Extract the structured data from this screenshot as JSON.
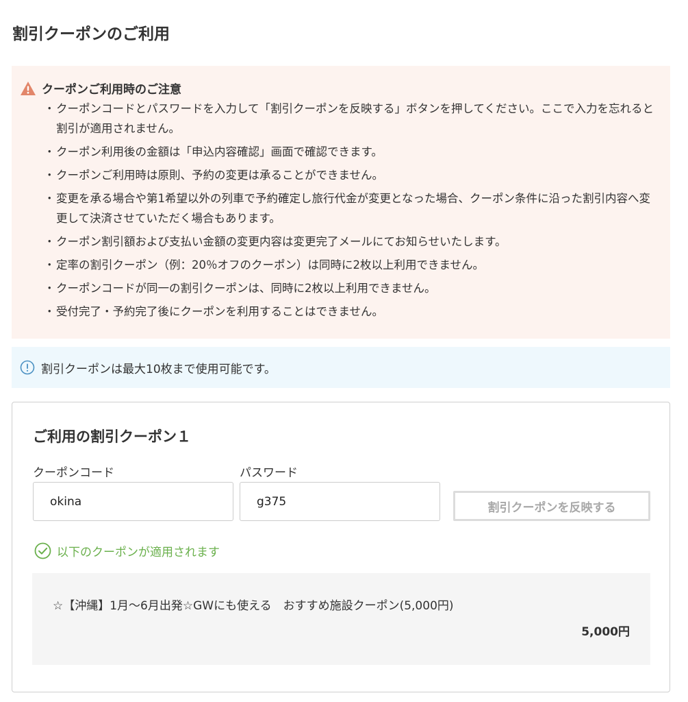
{
  "page": {
    "title": "割引クーポンのご利用"
  },
  "notice": {
    "title": "クーポンご利用時のご注意",
    "items": [
      "クーポンコードとパスワードを入力して「割引クーポンを反映する」ボタンを押してください。ここで入力を忘れると割引が適用されません。",
      "クーポン利用後の金額は「申込内容確認」画面で確認できます。",
      "クーポンご利用時は原則、予約の変更は承ることができません。",
      "変更を承る場合や第1希望以外の列車で予約確定し旅行代金が変更となった場合、クーポン条件に沿った割引内容へ変更して決済させていただく場合もあります。",
      "クーポン割引額および支払い金額の変更内容は変更完了メールにてお知らせいたします。",
      "定率の割引クーポン（例：20％オフのクーポン）は同時に2枚以上利用できません。",
      "クーポンコードが同一の割引クーポンは、同時に2枚以上利用できません。",
      "受付完了・予約完了後にクーポンを利用することはできません。"
    ]
  },
  "info": {
    "text": "割引クーポンは最大10枚まで使用可能です。"
  },
  "coupon": {
    "title": "ご利用の割引クーポン１",
    "code_label": "クーポンコード",
    "code_value": "okina",
    "password_label": "パスワード",
    "password_value": "g375",
    "apply_label": "割引クーポンを反映する",
    "success_text": "以下のクーポンが適用されます",
    "applied": {
      "name": "☆【沖縄】1月〜6月出発☆GWにも使える　おすすめ施設クーポン(5,000円)",
      "amount": "5,000円"
    }
  },
  "colors": {
    "warning": "#e2866a",
    "notice_bg": "#fdf3ef",
    "info_bg": "#eef8fd",
    "info_icon": "#4a90c2",
    "success": "#6ab04c",
    "disabled_text": "#a8a8a8"
  },
  "icons": {
    "warning": "warning-triangle-icon",
    "info": "info-circle-icon",
    "success": "check-circle-icon"
  }
}
